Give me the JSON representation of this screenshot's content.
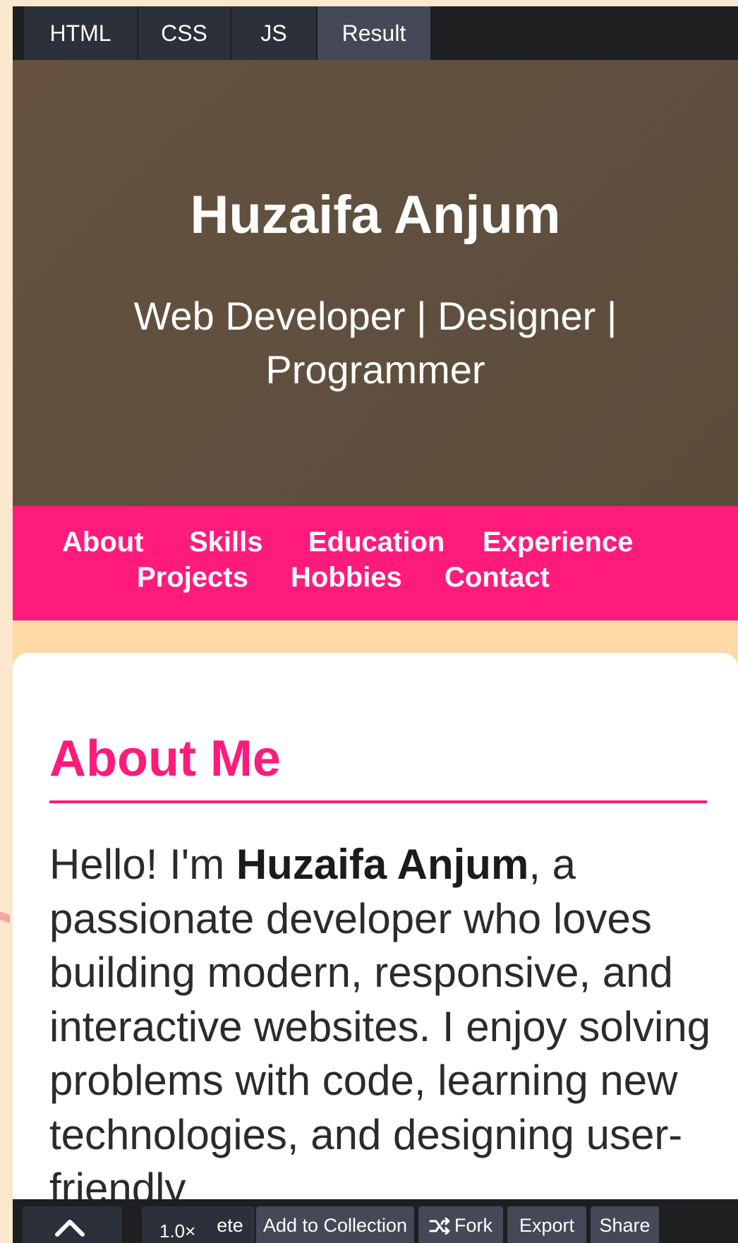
{
  "editor_tabs": {
    "html": "HTML",
    "css": "CSS",
    "js": "JS",
    "result": "Result"
  },
  "hero": {
    "name": "Huzaifa Anjum",
    "tagline": "Web Developer | Designer | Programmer"
  },
  "nav": {
    "about": "About",
    "skills": "Skills",
    "education": "Education",
    "experience": "Experience",
    "projects": "Projects",
    "hobbies": "Hobbies",
    "contact": "Contact"
  },
  "about": {
    "title": "About Me",
    "intro": "Hello! I'm ",
    "name": "Huzaifa Anjum",
    "body": ", a passionate developer who loves building modern, responsive, and interactive websites. I enjoy solving problems with code, learning new technologies, and designing user-friendly"
  },
  "toolbar": {
    "zoom": "1.0×",
    "delete_partial": "ete",
    "add_to_collection": "Add to Collection",
    "fork": "Fork",
    "export": "Export",
    "share": "Share"
  },
  "icons": {
    "toggle": "chevron-up-icon",
    "fork": "fork-icon"
  },
  "colors": {
    "accent_pink": "#ff1b7c",
    "hero_brown": "#5f4f3e",
    "page_peach": "#ffd9a6",
    "editor_dark": "#1d1f20"
  }
}
